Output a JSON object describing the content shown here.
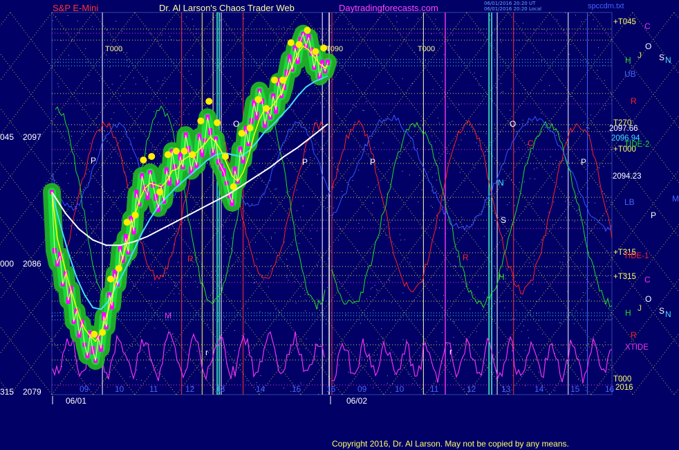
{
  "header": {
    "instrument": "S&P E-Mini",
    "site": "Dr. Al Larson's Chaos Trader Web",
    "url": "Daytradingforecasts.com",
    "stamp1": "06/01/2016 20:20 UT",
    "stamp2": "06/01/2016 20:20 Local",
    "file": "spccdm.txt"
  },
  "copyright": "Copyright 2016, Dr. Al Larson. May not be copied by any means.",
  "colors": {
    "background": "#000066",
    "price_bars": "#ff00ff",
    "band_glow": "#22bb22",
    "top_dots": "#ffee00",
    "fast_ma": "#ffff00",
    "mid_ma": "#44ddff",
    "slow_ma": "#ffffff",
    "tide_1": "#ff2222",
    "tide_2": "#22dd22",
    "xtide": "#ee33ee",
    "grid_yellow": "#dddd44"
  },
  "left_axis": [
    {
      "label": "045",
      "price": "2097"
    },
    {
      "label": "000",
      "price": "2086"
    },
    {
      "label": "315",
      "price": "2079"
    }
  ],
  "right_labels": [
    {
      "text": "+T045",
      "color": "#ffff66"
    },
    {
      "text": "T270",
      "color": "#ffff66"
    },
    {
      "text": "2097.66",
      "color": "#ffffff"
    },
    {
      "text": "2096.94",
      "color": "#44ddff"
    },
    {
      "text": "+T000",
      "color": "#ffff66"
    },
    {
      "text": "TIDE-2",
      "color": "#22dd22"
    },
    {
      "text": "2094.23",
      "color": "#ffffff"
    },
    {
      "text": "+T315",
      "color": "#ffff66"
    },
    {
      "text": "TIDE-1",
      "color": "#ff2222"
    },
    {
      "text": "+T315",
      "color": "#ffff66"
    },
    {
      "text": "XTIDE",
      "color": "#ee33ee"
    },
    {
      "text": "T000",
      "color": "#ffff66"
    },
    {
      "text": "2016",
      "color": "#ffff66"
    }
  ],
  "top_time_labels": [
    "T000",
    "T090",
    "T000"
  ],
  "hour_ticks": [
    "09",
    "10",
    "11",
    "12",
    "13",
    "14",
    "15",
    "16",
    "09",
    "10",
    "11",
    "12",
    "13",
    "14",
    "15",
    "16"
  ],
  "date_labels": [
    "06/01",
    "06/02"
  ],
  "planet_labels_upper": [
    {
      "text": "C",
      "color": "#ee33ee"
    },
    {
      "text": "O",
      "color": "#ffffff"
    },
    {
      "text": "H",
      "color": "#22dd22"
    },
    {
      "text": "J",
      "color": "#dddd44"
    },
    {
      "text": "S",
      "color": "#ffffff"
    },
    {
      "text": "N",
      "color": "#44ddff"
    },
    {
      "text": "UB",
      "color": "#4466ff"
    },
    {
      "text": "R",
      "color": "#ff2222"
    }
  ],
  "planet_labels_lower": [
    {
      "text": "C",
      "color": "#ee33ee"
    },
    {
      "text": "O",
      "color": "#ffffff"
    },
    {
      "text": "H",
      "color": "#22dd22"
    },
    {
      "text": "J",
      "color": "#dddd44"
    },
    {
      "text": "S",
      "color": "#ffffff"
    },
    {
      "text": "N",
      "color": "#44ddff"
    },
    {
      "text": "R",
      "color": "#ff2222"
    },
    {
      "text": "LB",
      "color": "#4466ff"
    },
    {
      "text": "P",
      "color": "#ffffff"
    },
    {
      "text": "M",
      "color": "#4466ff"
    }
  ],
  "chart_labels": [
    {
      "text": "P",
      "color": "#ffffff"
    },
    {
      "text": "O",
      "color": "#ffffff"
    },
    {
      "text": "P",
      "color": "#ffffff"
    },
    {
      "text": "P",
      "color": "#ffffff"
    },
    {
      "text": "O",
      "color": "#ffffff"
    },
    {
      "text": "P",
      "color": "#ffffff"
    },
    {
      "text": "N",
      "color": "#44ddff"
    },
    {
      "text": "S",
      "color": "#ffffff"
    },
    {
      "text": "H",
      "color": "#22dd22"
    },
    {
      "text": "R",
      "color": "#ff2222"
    },
    {
      "text": "C",
      "color": "#ff2222"
    },
    {
      "text": "R",
      "color": "#ff2222"
    },
    {
      "text": "M",
      "color": "#ee33ee"
    },
    {
      "text": "r",
      "color": "#ffffff"
    },
    {
      "text": "r",
      "color": "#ffffff"
    }
  ],
  "chart_data": {
    "type": "line",
    "title": "S&P E-Mini",
    "xlabel": "",
    "ylabel": "",
    "ylim": [
      2079,
      2100.5
    ],
    "session_dates": [
      "06/01",
      "06/02"
    ],
    "grid": true,
    "last_price": 2097.66,
    "ma_mid_last": 2096.94,
    "ma_slow_last": 2094.23,
    "series": [
      {
        "name": "price",
        "x": [
          0,
          2,
          4,
          6,
          8,
          10,
          12,
          14,
          16,
          18,
          20,
          22,
          24,
          26,
          28,
          30,
          32,
          34,
          36,
          38,
          40,
          42,
          44,
          46,
          48,
          50,
          52,
          54,
          56,
          58,
          60,
          62,
          64,
          66,
          68,
          70,
          72,
          74,
          76,
          78,
          80,
          82,
          84,
          86,
          88,
          90,
          92,
          94,
          96,
          98,
          100,
          102,
          104,
          106,
          108,
          110,
          112,
          114,
          116,
          118,
          120,
          122,
          124,
          126,
          128,
          130,
          132,
          134,
          136,
          138,
          140,
          142,
          144,
          146,
          148,
          150,
          152,
          154,
          156,
          158,
          160,
          162,
          164,
          166,
          168,
          170,
          172,
          174,
          176,
          178,
          180,
          182,
          184,
          186,
          188,
          190,
          192,
          194,
          196,
          198,
          200,
          202
        ],
        "y": [
          2090.4,
          2087.1,
          2086.4,
          2086.8,
          2085.2,
          2085.8,
          2084.3,
          2084.9,
          2083.1,
          2083.7,
          2082.4,
          2083.0,
          2081.8,
          2081.2,
          2082.4,
          2081.5,
          2080.9,
          2082.2,
          2081.6,
          2083.4,
          2082.8,
          2084.6,
          2084.0,
          2085.8,
          2085.2,
          2087.2,
          2086.6,
          2087.8,
          2087.0,
          2088.9,
          2088.2,
          2090.3,
          2089.7,
          2091.3,
          2090.6,
          2090.2,
          2091.5,
          2090.8,
          2090.1,
          2089.5,
          2090.7,
          2089.9,
          2091.6,
          2091.0,
          2092.7,
          2091.8,
          2090.9,
          2092.4,
          2091.8,
          2093.6,
          2092.8,
          2091.6,
          2092.4,
          2091.9,
          2093.5,
          2092.6,
          2093.3,
          2094.6,
          2093.8,
          2092.6,
          2093.4,
          2092.1,
          2091.8,
          2091.5,
          2090.9,
          2090.2,
          2089.8,
          2091.6,
          2091.0,
          2092.8,
          2092.2,
          2093.9,
          2093.1,
          2094.4,
          2095.4,
          2094.7,
          2096.1,
          2095.5,
          2094.2,
          2095.0,
          2094.6,
          2095.8,
          2095.0,
          2096.6,
          2095.8,
          2096.3,
          2097.1,
          2097.9,
          2097.3,
          2098.5,
          2097.8,
          2098.9,
          2099.3,
          2098.6,
          2099.1,
          2098.3,
          2097.4,
          2098.2,
          2096.9,
          2097.6,
          2097.2,
          2097.7
        ]
      },
      {
        "name": "fast-ma",
        "x": [
          0,
          4,
          8,
          12,
          16,
          20,
          24,
          28,
          32,
          36,
          40,
          44,
          48,
          52,
          56,
          60,
          64,
          68,
          72,
          76,
          80,
          84,
          88,
          92,
          96,
          100,
          104,
          108,
          112,
          116,
          120,
          124,
          128,
          132,
          136,
          140,
          144,
          148,
          152,
          156,
          160,
          164,
          168,
          172,
          176,
          180,
          184,
          188,
          192,
          196,
          200,
          202
        ],
        "y": [
          2090.4,
          2087.8,
          2086.6,
          2085.4,
          2084.4,
          2083.4,
          2082.7,
          2082.3,
          2082.0,
          2082.5,
          2083.4,
          2084.5,
          2085.7,
          2086.8,
          2087.8,
          2088.9,
          2089.9,
          2090.6,
          2090.9,
          2090.8,
          2090.7,
          2091.0,
          2091.6,
          2091.7,
          2092.2,
          2092.4,
          2092.5,
          2092.8,
          2093.1,
          2093.5,
          2093.2,
          2092.7,
          2092.0,
          2091.3,
          2091.0,
          2091.5,
          2092.4,
          2093.6,
          2094.5,
          2095.1,
          2095.1,
          2095.5,
          2096.0,
          2096.8,
          2097.5,
          2098.2,
          2098.6,
          2098.4,
          2098.0,
          2097.6,
          2097.4,
          2097.5
        ]
      },
      {
        "name": "mid-ma",
        "x": [
          0,
          6,
          12,
          18,
          24,
          30,
          36,
          42,
          48,
          54,
          60,
          66,
          72,
          78,
          84,
          90,
          96,
          102,
          108,
          114,
          120,
          126,
          132,
          138,
          144,
          150,
          156,
          162,
          168,
          174,
          180,
          186,
          192,
          198,
          202
        ],
        "y": [
          2090.4,
          2088.6,
          2087.0,
          2085.6,
          2084.6,
          2083.9,
          2083.8,
          2084.3,
          2085.2,
          2086.1,
          2087.1,
          2088.1,
          2088.9,
          2089.6,
          2090.1,
          2090.6,
          2091.0,
          2091.4,
          2091.8,
          2092.2,
          2092.5,
          2092.6,
          2092.5,
          2092.4,
          2092.7,
          2093.2,
          2093.8,
          2094.2,
          2094.7,
          2095.2,
          2095.8,
          2096.3,
          2096.6,
          2096.8,
          2096.94
        ]
      },
      {
        "name": "slow-ma",
        "x": [
          0,
          10,
          20,
          30,
          40,
          50,
          60,
          70,
          80,
          90,
          100,
          110,
          120,
          130,
          140,
          150,
          160,
          170,
          180,
          190,
          202
        ],
        "y": [
          2090.4,
          2089.2,
          2088.3,
          2087.7,
          2087.4,
          2087.4,
          2087.6,
          2087.9,
          2088.3,
          2088.7,
          2089.1,
          2089.5,
          2089.9,
          2090.3,
          2090.8,
          2091.3,
          2091.8,
          2092.4,
          2092.9,
          2093.5,
          2094.23
        ]
      }
    ]
  }
}
